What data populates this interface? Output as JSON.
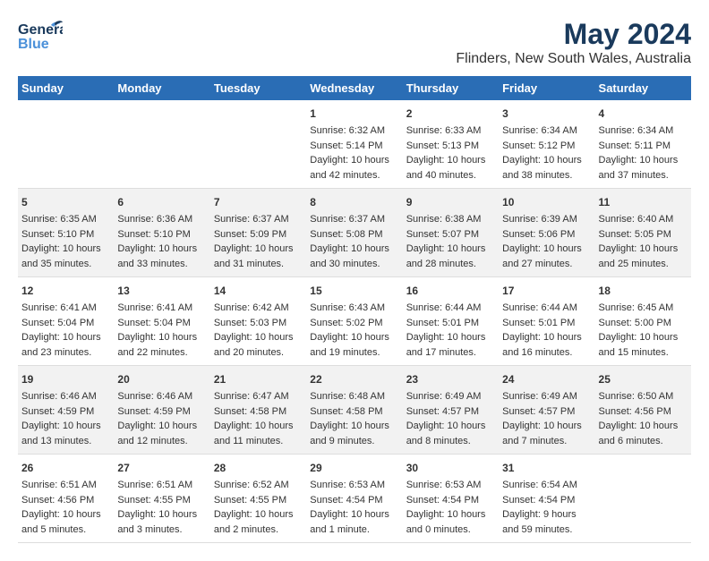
{
  "header": {
    "logo_general": "General",
    "logo_blue": "Blue",
    "title": "May 2024",
    "subtitle": "Flinders, New South Wales, Australia"
  },
  "days_of_week": [
    "Sunday",
    "Monday",
    "Tuesday",
    "Wednesday",
    "Thursday",
    "Friday",
    "Saturday"
  ],
  "weeks": [
    {
      "days": [
        {
          "num": "",
          "sunrise": "",
          "sunset": "",
          "daylight": ""
        },
        {
          "num": "",
          "sunrise": "",
          "sunset": "",
          "daylight": ""
        },
        {
          "num": "",
          "sunrise": "",
          "sunset": "",
          "daylight": ""
        },
        {
          "num": "1",
          "sunrise": "Sunrise: 6:32 AM",
          "sunset": "Sunset: 5:14 PM",
          "daylight": "Daylight: 10 hours and 42 minutes."
        },
        {
          "num": "2",
          "sunrise": "Sunrise: 6:33 AM",
          "sunset": "Sunset: 5:13 PM",
          "daylight": "Daylight: 10 hours and 40 minutes."
        },
        {
          "num": "3",
          "sunrise": "Sunrise: 6:34 AM",
          "sunset": "Sunset: 5:12 PM",
          "daylight": "Daylight: 10 hours and 38 minutes."
        },
        {
          "num": "4",
          "sunrise": "Sunrise: 6:34 AM",
          "sunset": "Sunset: 5:11 PM",
          "daylight": "Daylight: 10 hours and 37 minutes."
        }
      ]
    },
    {
      "days": [
        {
          "num": "5",
          "sunrise": "Sunrise: 6:35 AM",
          "sunset": "Sunset: 5:10 PM",
          "daylight": "Daylight: 10 hours and 35 minutes."
        },
        {
          "num": "6",
          "sunrise": "Sunrise: 6:36 AM",
          "sunset": "Sunset: 5:10 PM",
          "daylight": "Daylight: 10 hours and 33 minutes."
        },
        {
          "num": "7",
          "sunrise": "Sunrise: 6:37 AM",
          "sunset": "Sunset: 5:09 PM",
          "daylight": "Daylight: 10 hours and 31 minutes."
        },
        {
          "num": "8",
          "sunrise": "Sunrise: 6:37 AM",
          "sunset": "Sunset: 5:08 PM",
          "daylight": "Daylight: 10 hours and 30 minutes."
        },
        {
          "num": "9",
          "sunrise": "Sunrise: 6:38 AM",
          "sunset": "Sunset: 5:07 PM",
          "daylight": "Daylight: 10 hours and 28 minutes."
        },
        {
          "num": "10",
          "sunrise": "Sunrise: 6:39 AM",
          "sunset": "Sunset: 5:06 PM",
          "daylight": "Daylight: 10 hours and 27 minutes."
        },
        {
          "num": "11",
          "sunrise": "Sunrise: 6:40 AM",
          "sunset": "Sunset: 5:05 PM",
          "daylight": "Daylight: 10 hours and 25 minutes."
        }
      ]
    },
    {
      "days": [
        {
          "num": "12",
          "sunrise": "Sunrise: 6:41 AM",
          "sunset": "Sunset: 5:04 PM",
          "daylight": "Daylight: 10 hours and 23 minutes."
        },
        {
          "num": "13",
          "sunrise": "Sunrise: 6:41 AM",
          "sunset": "Sunset: 5:04 PM",
          "daylight": "Daylight: 10 hours and 22 minutes."
        },
        {
          "num": "14",
          "sunrise": "Sunrise: 6:42 AM",
          "sunset": "Sunset: 5:03 PM",
          "daylight": "Daylight: 10 hours and 20 minutes."
        },
        {
          "num": "15",
          "sunrise": "Sunrise: 6:43 AM",
          "sunset": "Sunset: 5:02 PM",
          "daylight": "Daylight: 10 hours and 19 minutes."
        },
        {
          "num": "16",
          "sunrise": "Sunrise: 6:44 AM",
          "sunset": "Sunset: 5:01 PM",
          "daylight": "Daylight: 10 hours and 17 minutes."
        },
        {
          "num": "17",
          "sunrise": "Sunrise: 6:44 AM",
          "sunset": "Sunset: 5:01 PM",
          "daylight": "Daylight: 10 hours and 16 minutes."
        },
        {
          "num": "18",
          "sunrise": "Sunrise: 6:45 AM",
          "sunset": "Sunset: 5:00 PM",
          "daylight": "Daylight: 10 hours and 15 minutes."
        }
      ]
    },
    {
      "days": [
        {
          "num": "19",
          "sunrise": "Sunrise: 6:46 AM",
          "sunset": "Sunset: 4:59 PM",
          "daylight": "Daylight: 10 hours and 13 minutes."
        },
        {
          "num": "20",
          "sunrise": "Sunrise: 6:46 AM",
          "sunset": "Sunset: 4:59 PM",
          "daylight": "Daylight: 10 hours and 12 minutes."
        },
        {
          "num": "21",
          "sunrise": "Sunrise: 6:47 AM",
          "sunset": "Sunset: 4:58 PM",
          "daylight": "Daylight: 10 hours and 11 minutes."
        },
        {
          "num": "22",
          "sunrise": "Sunrise: 6:48 AM",
          "sunset": "Sunset: 4:58 PM",
          "daylight": "Daylight: 10 hours and 9 minutes."
        },
        {
          "num": "23",
          "sunrise": "Sunrise: 6:49 AM",
          "sunset": "Sunset: 4:57 PM",
          "daylight": "Daylight: 10 hours and 8 minutes."
        },
        {
          "num": "24",
          "sunrise": "Sunrise: 6:49 AM",
          "sunset": "Sunset: 4:57 PM",
          "daylight": "Daylight: 10 hours and 7 minutes."
        },
        {
          "num": "25",
          "sunrise": "Sunrise: 6:50 AM",
          "sunset": "Sunset: 4:56 PM",
          "daylight": "Daylight: 10 hours and 6 minutes."
        }
      ]
    },
    {
      "days": [
        {
          "num": "26",
          "sunrise": "Sunrise: 6:51 AM",
          "sunset": "Sunset: 4:56 PM",
          "daylight": "Daylight: 10 hours and 5 minutes."
        },
        {
          "num": "27",
          "sunrise": "Sunrise: 6:51 AM",
          "sunset": "Sunset: 4:55 PM",
          "daylight": "Daylight: 10 hours and 3 minutes."
        },
        {
          "num": "28",
          "sunrise": "Sunrise: 6:52 AM",
          "sunset": "Sunset: 4:55 PM",
          "daylight": "Daylight: 10 hours and 2 minutes."
        },
        {
          "num": "29",
          "sunrise": "Sunrise: 6:53 AM",
          "sunset": "Sunset: 4:54 PM",
          "daylight": "Daylight: 10 hours and 1 minute."
        },
        {
          "num": "30",
          "sunrise": "Sunrise: 6:53 AM",
          "sunset": "Sunset: 4:54 PM",
          "daylight": "Daylight: 10 hours and 0 minutes."
        },
        {
          "num": "31",
          "sunrise": "Sunrise: 6:54 AM",
          "sunset": "Sunset: 4:54 PM",
          "daylight": "Daylight: 9 hours and 59 minutes."
        },
        {
          "num": "",
          "sunrise": "",
          "sunset": "",
          "daylight": ""
        }
      ]
    }
  ]
}
